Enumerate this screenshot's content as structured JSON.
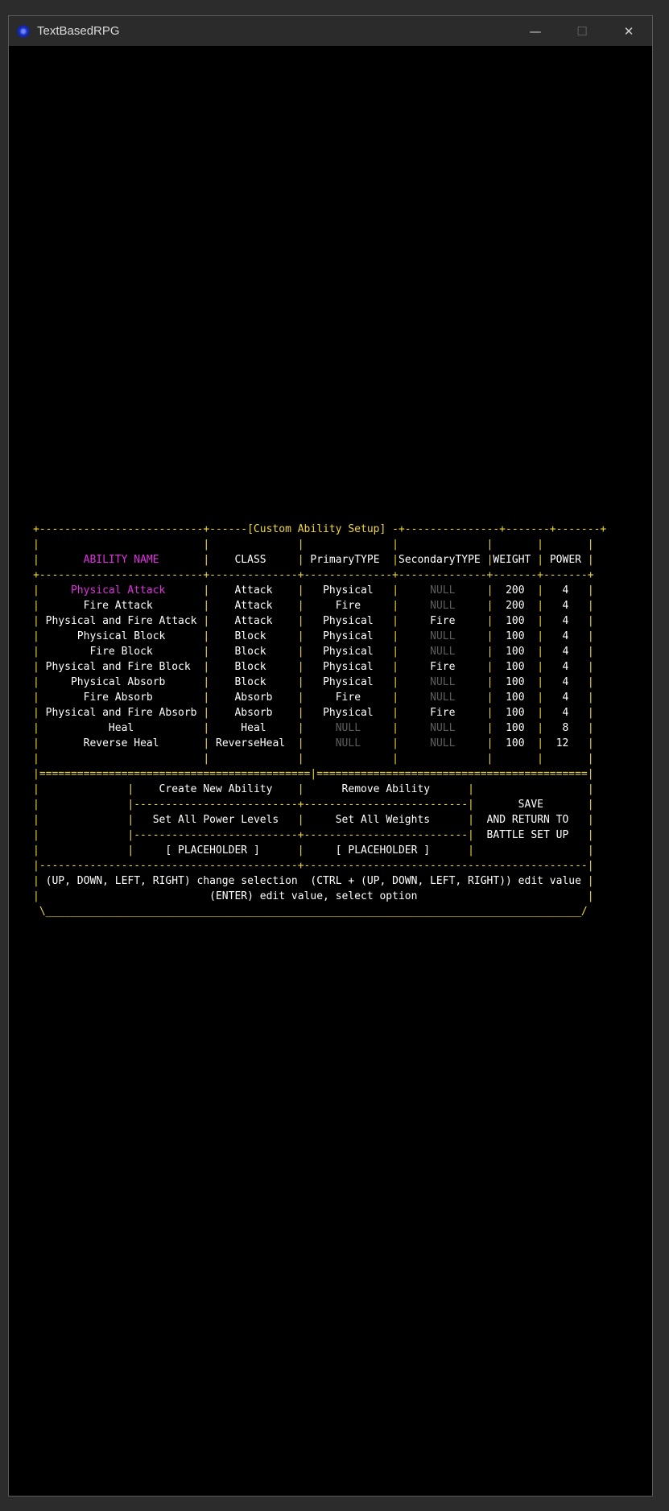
{
  "window": {
    "title": "TextBasedRPG"
  },
  "setup": {
    "heading": "[Custom Ability Setup]",
    "headers": {
      "name": "ABILITY NAME",
      "class": "CLASS",
      "primary": "PrimaryTYPE",
      "secondary": "SecondaryTYPE",
      "weight": "WEIGHT",
      "power": "POWER"
    },
    "rows": [
      {
        "name": "Physical Attack",
        "class": "Attack",
        "primary": "Physical",
        "secondary": "NULL",
        "weight": "200",
        "power": "4",
        "selected": true
      },
      {
        "name": "Fire Attack",
        "class": "Attack",
        "primary": "Fire",
        "secondary": "NULL",
        "weight": "200",
        "power": "4"
      },
      {
        "name": "Physical and Fire Attack",
        "class": "Attack",
        "primary": "Physical",
        "secondary": "Fire",
        "weight": "100",
        "power": "4"
      },
      {
        "name": "Physical Block",
        "class": "Block",
        "primary": "Physical",
        "secondary": "NULL",
        "weight": "100",
        "power": "4"
      },
      {
        "name": "Fire Block",
        "class": "Block",
        "primary": "Physical",
        "secondary": "NULL",
        "weight": "100",
        "power": "4"
      },
      {
        "name": "Physical and Fire Block",
        "class": "Block",
        "primary": "Physical",
        "secondary": "Fire",
        "weight": "100",
        "power": "4"
      },
      {
        "name": "Physical Absorb",
        "class": "Block",
        "primary": "Physical",
        "secondary": "NULL",
        "weight": "100",
        "power": "4"
      },
      {
        "name": "Fire Absorb",
        "class": "Absorb",
        "primary": "Fire",
        "secondary": "NULL",
        "weight": "100",
        "power": "4"
      },
      {
        "name": "Physical and Fire Absorb",
        "class": "Absorb",
        "primary": "Physical",
        "secondary": "Fire",
        "weight": "100",
        "power": "4"
      },
      {
        "name": "Heal",
        "class": "Heal",
        "primary": "NULL",
        "secondary": "NULL",
        "weight": "100",
        "power": "8"
      },
      {
        "name": "Reverse Heal",
        "class": "ReverseHeal",
        "primary": "NULL",
        "secondary": "NULL",
        "weight": "100",
        "power": "12"
      }
    ],
    "menu": {
      "create_new": "Create New Ability",
      "remove": "Remove Ability",
      "set_power": "Set All Power Levels",
      "set_weights": "Set All Weights",
      "placeholder_1": "[ PLACEHOLDER ]",
      "placeholder_2": "[ PLACEHOLDER ]",
      "save_line1": "SAVE",
      "save_line2": "AND RETURN TO",
      "save_line3": "BATTLE SET UP"
    },
    "help": {
      "line1_left": "(UP, DOWN, LEFT, RIGHT) change selection",
      "line1_right": "(CTRL + (UP, DOWN, LEFT, RIGHT)) edit value",
      "line2": "(ENTER) edit value, select option"
    }
  },
  "colors": {
    "frame": "#f0d83a",
    "selected": "#e030e0",
    "null_text": "#5e5e5e",
    "text": "#ffffff",
    "background": "#000000"
  }
}
